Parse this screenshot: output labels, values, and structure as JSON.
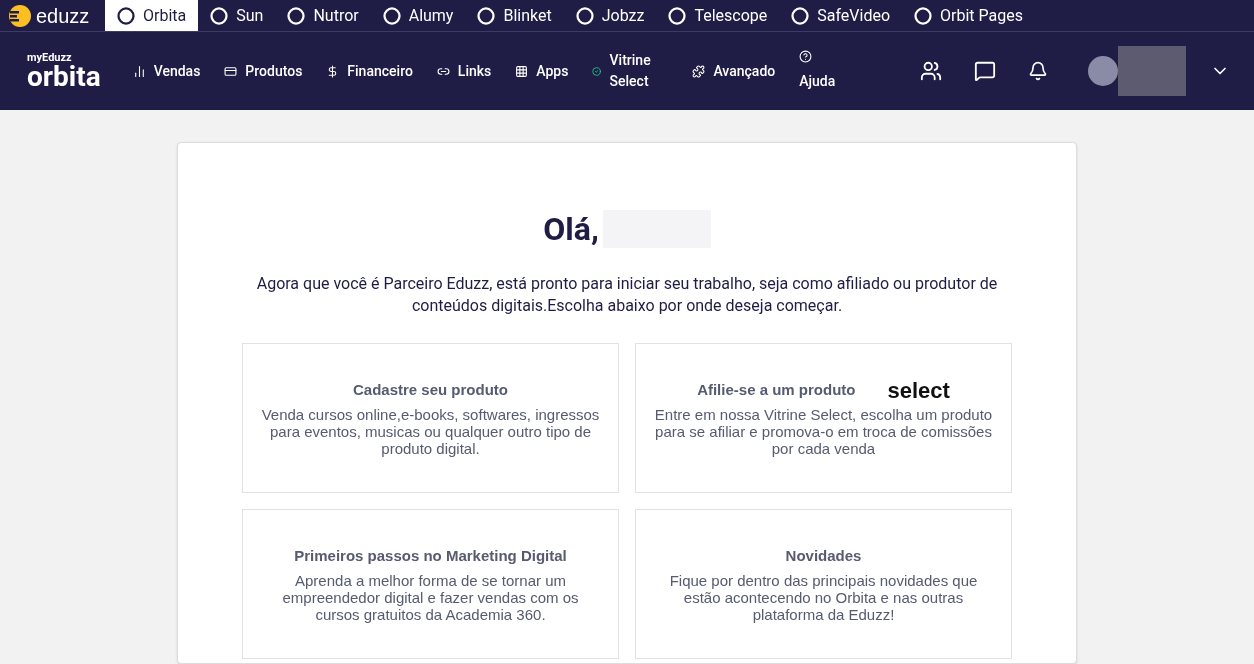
{
  "apps_bar": {
    "logo": "eduzz",
    "apps": [
      {
        "label": "Orbita",
        "selected": true
      },
      {
        "label": "Sun",
        "selected": false
      },
      {
        "label": "Nutror",
        "selected": false
      },
      {
        "label": "Alumy",
        "selected": false
      },
      {
        "label": "Blinket",
        "selected": false
      },
      {
        "label": "Jobzz",
        "selected": false
      },
      {
        "label": "Telescope",
        "selected": false
      },
      {
        "label": "SafeVideo",
        "selected": false
      },
      {
        "label": "Orbit Pages",
        "selected": false
      }
    ]
  },
  "nav": {
    "logo_top": "myEduzz",
    "logo": "orbita",
    "items": [
      {
        "kind": "chart",
        "label": "Vendas"
      },
      {
        "kind": "list",
        "label": "Produtos"
      },
      {
        "kind": "dollar",
        "label": "Financeiro"
      },
      {
        "kind": "link",
        "label": "Links"
      },
      {
        "kind": "grid",
        "label": "Apps"
      },
      {
        "kind": "check",
        "label": "Vitrine Select"
      },
      {
        "kind": "puzzle",
        "label": "Avançado"
      },
      {
        "kind": "help",
        "label": "Ajuda"
      }
    ]
  },
  "greeting": "Olá,",
  "intro": "Agora que você é Parceiro Eduzz, está pronto para iniciar seu trabalho, seja como afiliado ou produtor de conteúdos digitais.Escolha abaixo por onde deseja começar.",
  "cards": [
    {
      "title": "Cadastre seu produto",
      "text": "Venda cursos online,e-books, softwares, ingressos para eventos, musicas ou qualquer outro tipo de produto digital."
    },
    {
      "title": "Afilie-se a um produto",
      "logo": "select",
      "text": "Entre em nossa Vitrine Select, escolha um produto para se afiliar e promova-o em troca de comissões por cada venda"
    },
    {
      "title": "Primeiros passos no Marketing Digital",
      "text": "Aprenda a melhor forma de se tornar um empreendedor digital e fazer vendas com os cursos gratuitos da Academia 360."
    },
    {
      "title": "Novidades",
      "text": "Fique por dentro das principais novidades que estão acontecendo no Orbita e nas outras plataforma da Eduzz!"
    }
  ]
}
